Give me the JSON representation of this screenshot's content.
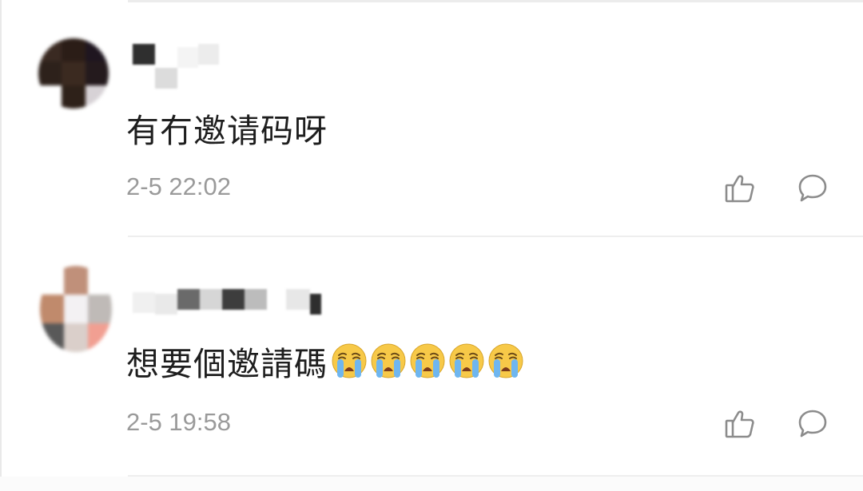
{
  "comments": [
    {
      "text": "有冇邀请码呀",
      "time": "2-5 22:02",
      "avatar_colors": [
        "#3a2a22",
        "#2b1d17",
        "#1f1620",
        "#2d211b",
        "#3b2a20",
        "#241a1d",
        "#ffffff",
        "#2e2119",
        "#d7d2d6"
      ],
      "name_blocks": [
        "#2f2f2f",
        "#dcdcdc",
        "#f4f4f4",
        "#ececec"
      ]
    },
    {
      "text": "想要個邀請碼",
      "emoji_count": 5,
      "emoji_icon": "loudly-crying-face-icon",
      "time": "2-5 19:58",
      "avatar_colors": [
        "#ffffff",
        "#c0907a",
        "#ffffff",
        "#c08a6c",
        "#f3f1f3",
        "#bfbab7",
        "#595959",
        "#dacfca",
        "#f19f92"
      ],
      "name_blocks": [
        "#f0f0f0",
        "#e9e9e9",
        "#6a6a6a",
        "#d6d6d6",
        "#3d3d3d",
        "#bcbcbc",
        "#ffffff",
        "#e7e7e7",
        "#2e2e2e"
      ]
    }
  ],
  "icons": {
    "like": "thumbs-up-icon",
    "reply": "comment-bubble-icon"
  },
  "colors": {
    "text": "#1e1e1e",
    "meta": "#9a9a9a",
    "divider": "#eeeeee",
    "emoji_face": "#f7c948",
    "emoji_tear": "#6fb6ef"
  }
}
